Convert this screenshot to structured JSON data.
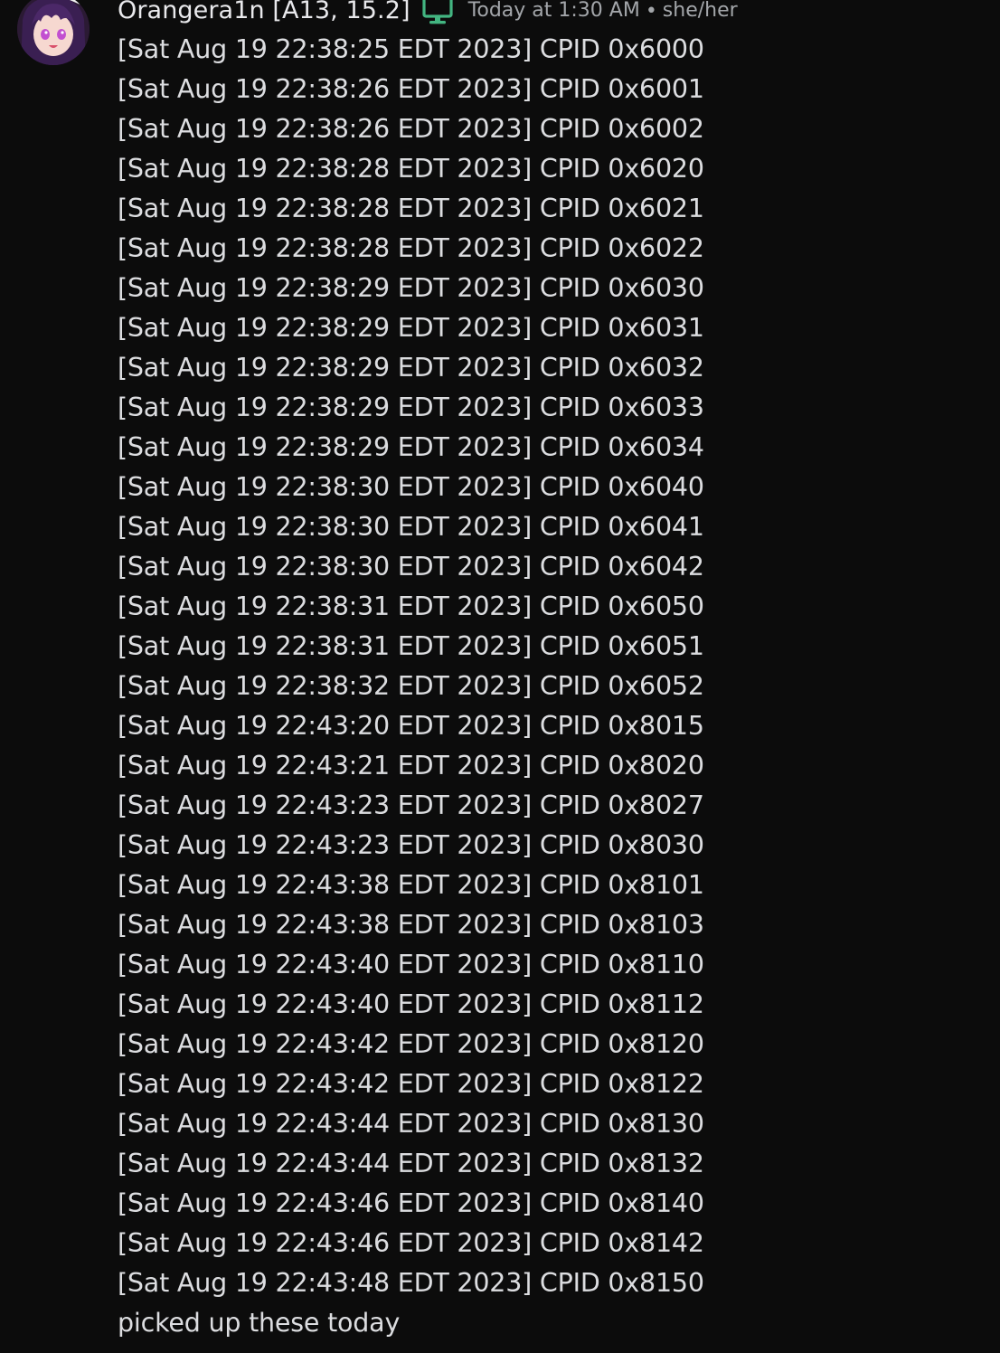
{
  "message": {
    "author": {
      "username": "Orangera1n [A13, 15.2]",
      "avatar_icon": "anime-avatar-icon",
      "platform_icon": "desktop-monitor-icon",
      "platform_icon_color": "#43b581",
      "pronouns": "she/her"
    },
    "timestamp": "Today at 1:30 AM",
    "separator": "•",
    "lines": [
      "[Sat Aug 19 22:38:25 EDT 2023] CPID 0x6000",
      "[Sat Aug 19 22:38:26 EDT 2023] CPID 0x6001",
      "[Sat Aug 19 22:38:26 EDT 2023] CPID 0x6002",
      "[Sat Aug 19 22:38:28 EDT 2023] CPID 0x6020",
      "[Sat Aug 19 22:38:28 EDT 2023] CPID 0x6021",
      "[Sat Aug 19 22:38:28 EDT 2023] CPID 0x6022",
      "[Sat Aug 19 22:38:29 EDT 2023] CPID 0x6030",
      "[Sat Aug 19 22:38:29 EDT 2023] CPID 0x6031",
      "[Sat Aug 19 22:38:29 EDT 2023] CPID 0x6032",
      "[Sat Aug 19 22:38:29 EDT 2023] CPID 0x6033",
      "[Sat Aug 19 22:38:29 EDT 2023] CPID 0x6034",
      "[Sat Aug 19 22:38:30 EDT 2023] CPID 0x6040",
      "[Sat Aug 19 22:38:30 EDT 2023] CPID 0x6041",
      "[Sat Aug 19 22:38:30 EDT 2023] CPID 0x6042",
      "[Sat Aug 19 22:38:31 EDT 2023] CPID 0x6050",
      "[Sat Aug 19 22:38:31 EDT 2023] CPID 0x6051",
      "[Sat Aug 19 22:38:32 EDT 2023] CPID 0x6052",
      "[Sat Aug 19 22:43:20 EDT 2023] CPID 0x8015",
      "[Sat Aug 19 22:43:21 EDT 2023] CPID 0x8020",
      "[Sat Aug 19 22:43:23 EDT 2023] CPID 0x8027",
      "[Sat Aug 19 22:43:23 EDT 2023] CPID 0x8030",
      "[Sat Aug 19 22:43:38 EDT 2023] CPID 0x8101",
      "[Sat Aug 19 22:43:38 EDT 2023] CPID 0x8103",
      "[Sat Aug 19 22:43:40 EDT 2023] CPID 0x8110",
      "[Sat Aug 19 22:43:40 EDT 2023] CPID 0x8112",
      "[Sat Aug 19 22:43:42 EDT 2023] CPID 0x8120",
      "[Sat Aug 19 22:43:42 EDT 2023] CPID 0x8122",
      "[Sat Aug 19 22:43:44 EDT 2023] CPID 0x8130",
      "[Sat Aug 19 22:43:44 EDT 2023] CPID 0x8132",
      "[Sat Aug 19 22:43:46 EDT 2023] CPID 0x8140",
      "[Sat Aug 19 22:43:46 EDT 2023] CPID 0x8142",
      "[Sat Aug 19 22:43:48 EDT 2023] CPID 0x8150"
    ],
    "caption": "picked up these today"
  },
  "colors": {
    "background": "#0c0c0c",
    "text": "#dcdde0",
    "muted": "#a3a6aa",
    "username": "#e9e9ec"
  }
}
